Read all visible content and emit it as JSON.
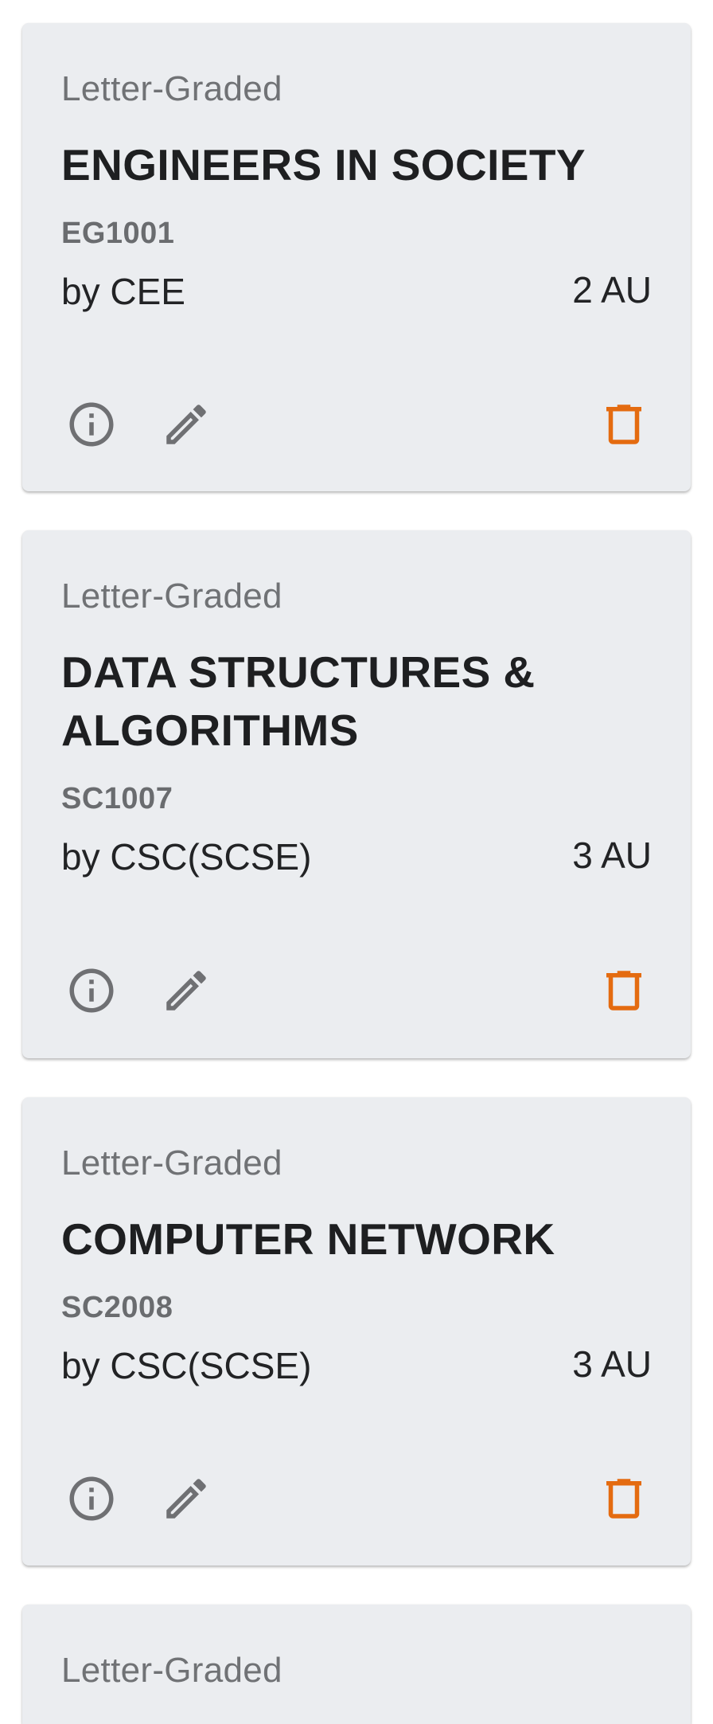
{
  "courses": [
    {
      "grading": "Letter-Graded",
      "title": "ENGINEERS IN SOCIETY",
      "code": "EG1001",
      "dept": "by CEE",
      "au": "2 AU"
    },
    {
      "grading": "Letter-Graded",
      "title": "DATA STRUCTURES & ALGORITHMS",
      "code": "SC1007",
      "dept": "by CSC(SCSE)",
      "au": "3 AU"
    },
    {
      "grading": "Letter-Graded",
      "title": "COMPUTER NETWORK",
      "code": "SC2008",
      "dept": "by CSC(SCSE)",
      "au": "3 AU"
    },
    {
      "grading": "Letter-Graded"
    }
  ],
  "icons": {
    "info": "info-circle-outline-icon",
    "edit": "pencil-icon",
    "delete": "trash-can-icon"
  },
  "colors": {
    "card_bg": "#ebedf0",
    "icon_gray": "#6f7073",
    "delete_accent": "#e46b10"
  }
}
